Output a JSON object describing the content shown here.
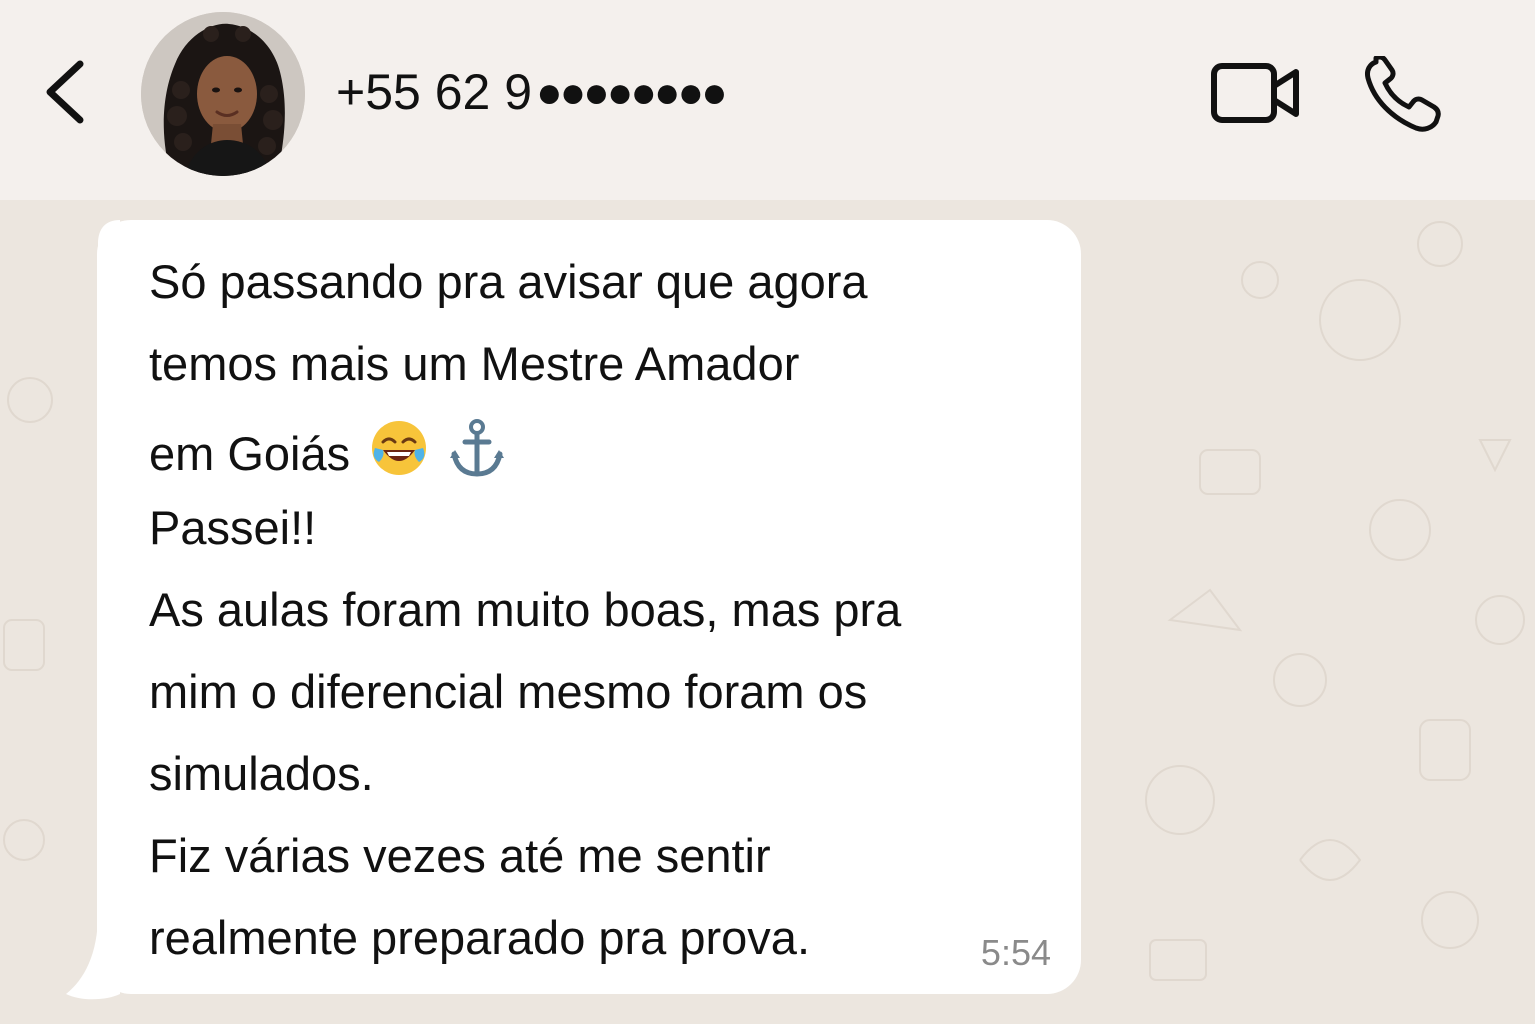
{
  "header": {
    "back_icon": "chevron-left-icon",
    "avatar_icon": "contact-avatar",
    "contact_number": "+55 62 9",
    "masked_digits": "●●●●●●●●",
    "video_icon": "video-camera-icon",
    "call_icon": "phone-icon"
  },
  "message": {
    "lines": [
      "Só passando pra avisar que agora",
      "temos mais um Mestre Amador",
      "em Goiás",
      "Passei!!",
      "As aulas foram muito boas, mas pra",
      "mim o diferencial mesmo foram os",
      "simulados.",
      "Fiz várias vezes até me sentir",
      "realmente preparado pra prova."
    ],
    "emojis": [
      "😂",
      "⚓"
    ],
    "time": "5:54"
  },
  "colors": {
    "header_bg": "#f4f0ed",
    "chat_bg": "#ece6df",
    "bubble_bg": "#ffffff",
    "text": "#111111",
    "time_text": "#8a8a8a"
  }
}
